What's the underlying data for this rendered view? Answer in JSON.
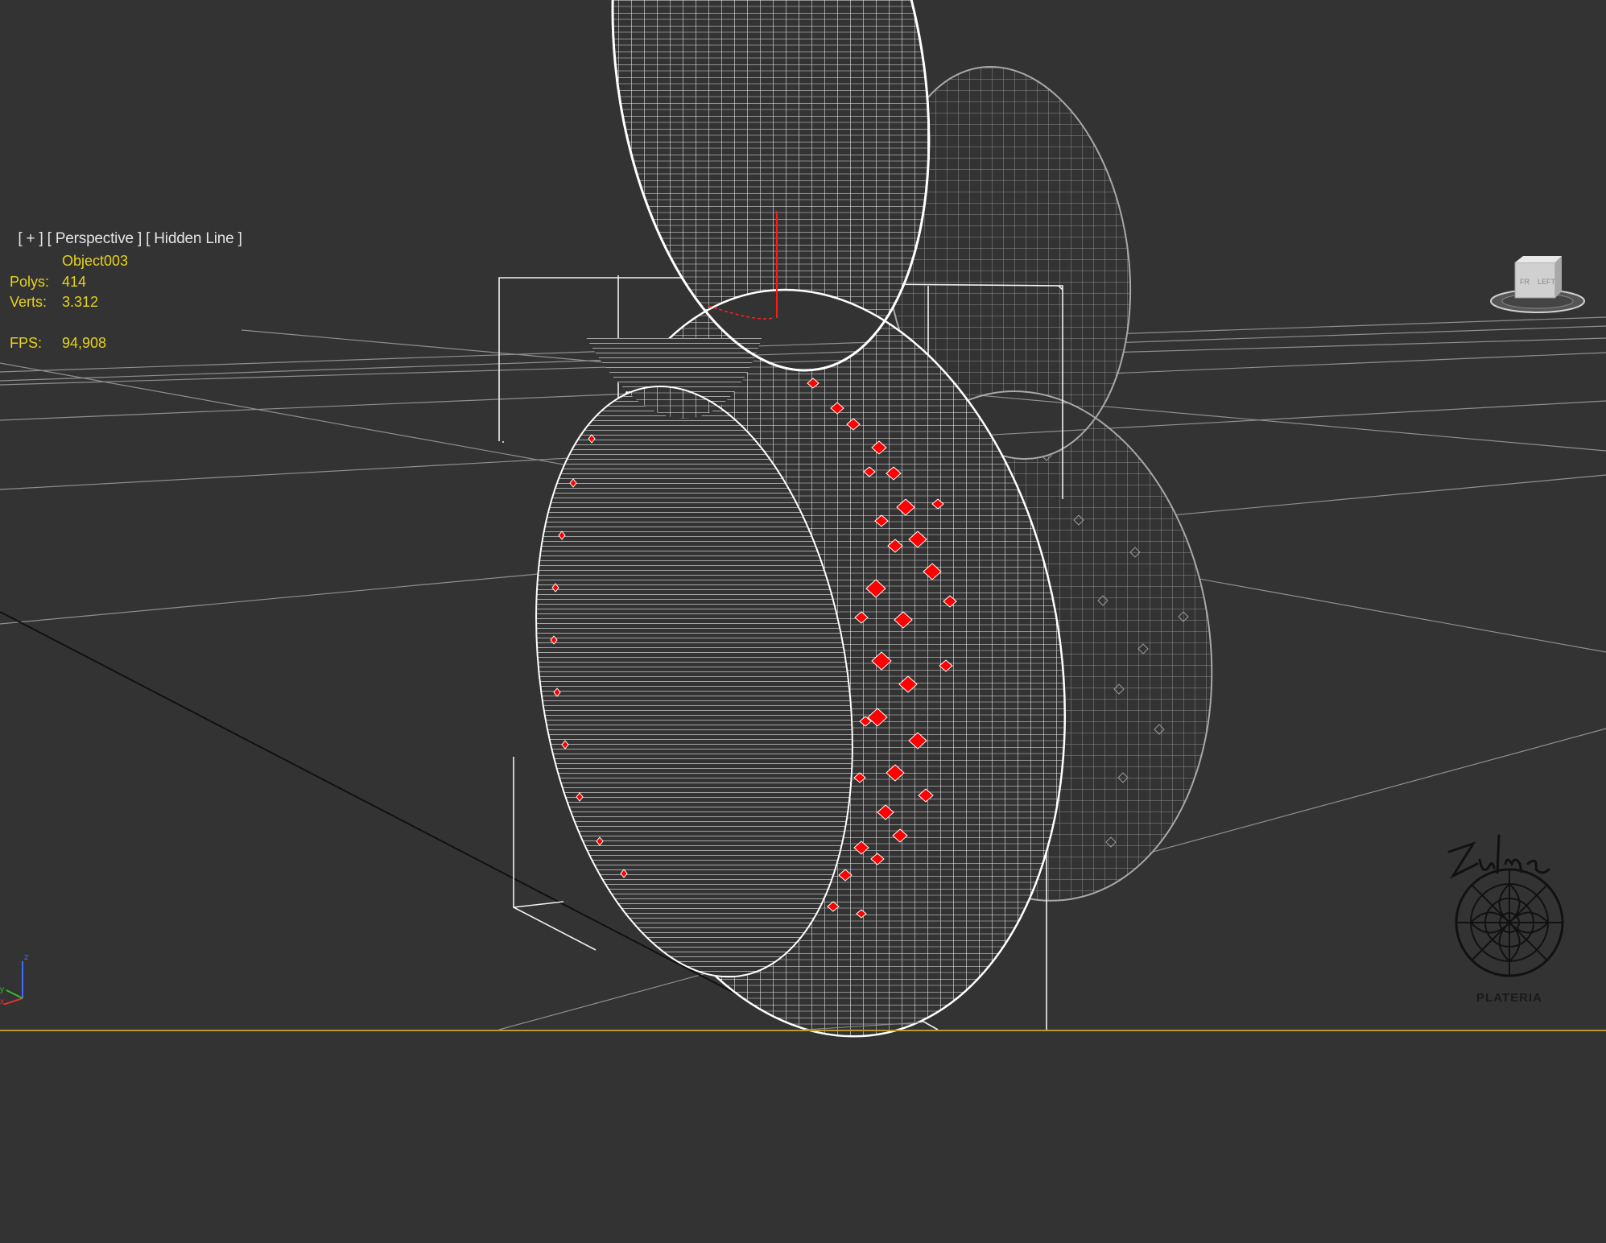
{
  "viewport": {
    "label_plus": "[ + ]",
    "label_view": "[ Perspective ]",
    "label_shading": "[ Hidden Line ]"
  },
  "stats": {
    "object_name": "Object003",
    "polys_label": "Polys:",
    "polys_value": "414",
    "verts_label": "Verts:",
    "verts_value": "3.312",
    "fps_label": "FPS:",
    "fps_value": "94,908"
  },
  "viewcube": {
    "face_left_text": "LEFT",
    "face_front_text": "FR"
  },
  "axes": {
    "z_label": "z",
    "x_label": "x",
    "y_label": "y"
  },
  "logo": {
    "text": "PLATERIA",
    "signature_text": "Zulma"
  },
  "colors": {
    "background": "#333333",
    "grid": "#9a9a9a",
    "wire": "#ffffff",
    "selected_face": "#ff0000",
    "stats_text": "#e6d21a",
    "label_text": "#e4e4e4",
    "bottom_line": "#b89a35"
  }
}
